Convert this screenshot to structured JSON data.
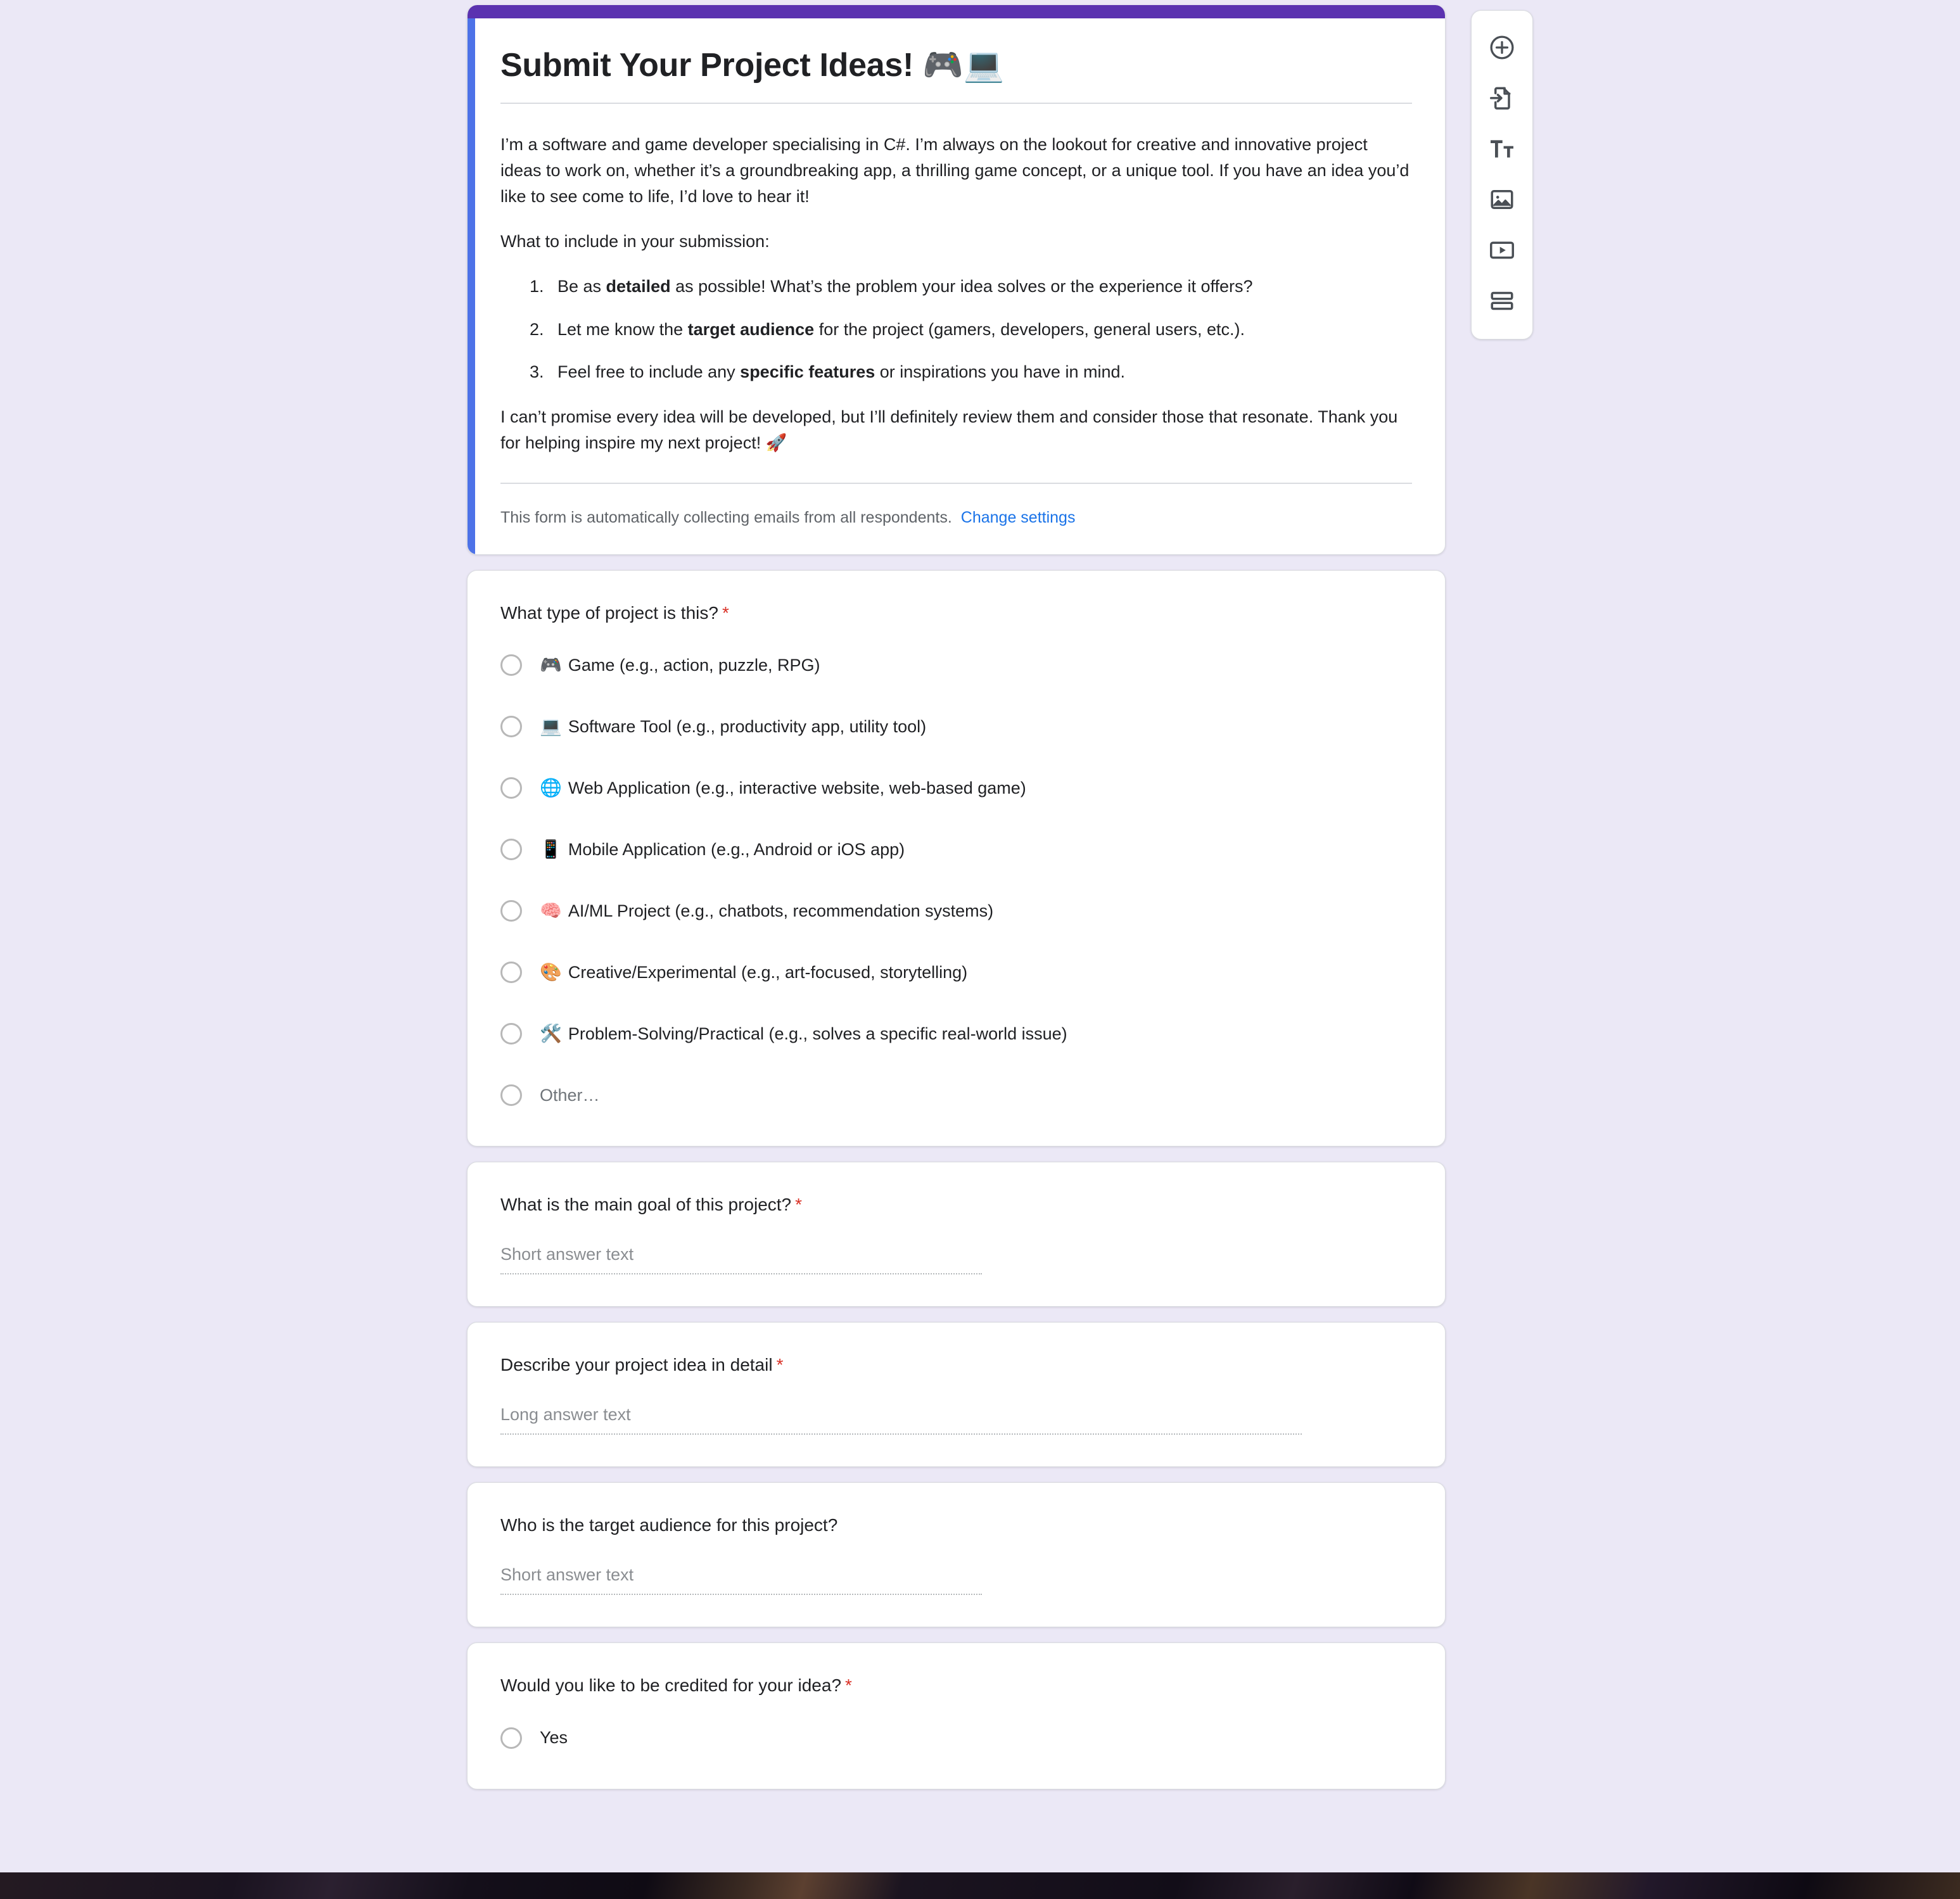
{
  "theme": {
    "header_bar_color": "#5b32b0",
    "selected_accent_color": "#4d72e8",
    "canvas_background": "#ebe8f6",
    "link_color": "#1a73e8",
    "required_star_color": "#d93025"
  },
  "header": {
    "title": "Submit Your Project Ideas! 🎮💻",
    "description_paragraphs": [
      "I’m a software and game developer specialising in C#. I’m always on the lookout for creative and innovative project ideas to work on, whether it’s a groundbreaking app, a thrilling game concept, or a unique tool. If you have an idea you’d like to see come to life, I’d love to hear it!",
      "What to include in your submission:"
    ],
    "list_items": [
      {
        "pre": "Be as ",
        "bold": "detailed",
        "post": " as possible! What’s the problem your idea solves or the experience it offers?"
      },
      {
        "pre": "Let me know the ",
        "bold": "target audience",
        "post": " for the project (gamers, developers, general users, etc.)."
      },
      {
        "pre": "Feel free to include any ",
        "bold": "specific features",
        "post": " or inspirations you have in mind."
      }
    ],
    "closing_paragraph": "I can’t promise every idea will be developed, but I’ll definitely review them and consider those that resonate. Thank you for helping inspire my next project! 🚀",
    "email_notice": "This form is automatically collecting emails from all respondents.",
    "email_notice_link": "Change settings"
  },
  "questions": [
    {
      "title": "What type of project is this?",
      "required": true,
      "type": "radio",
      "options": [
        {
          "emoji": "🎮",
          "label": "Game (e.g., action, puzzle, RPG)",
          "muted": false
        },
        {
          "emoji": "💻",
          "label": "Software Tool (e.g., productivity app, utility tool)",
          "muted": false
        },
        {
          "emoji": "🌐",
          "label": "Web Application (e.g., interactive website, web-based game)",
          "muted": false
        },
        {
          "emoji": "📱",
          "label": "Mobile Application (e.g., Android or iOS app)",
          "muted": false
        },
        {
          "emoji": "🧠",
          "label": "AI/ML Project (e.g., chatbots, recommendation systems)",
          "muted": false
        },
        {
          "emoji": "🎨",
          "label": "Creative/Experimental (e.g., art-focused, storytelling)",
          "muted": false
        },
        {
          "emoji": "🛠️",
          "label": "Problem-Solving/Practical (e.g., solves a specific real-world issue)",
          "muted": false
        },
        {
          "emoji": "",
          "label": "Other…",
          "muted": true
        }
      ]
    },
    {
      "title": "What is the main goal of this project?",
      "required": true,
      "type": "short_answer",
      "placeholder": "Short answer text"
    },
    {
      "title": "Describe your project idea in detail",
      "required": true,
      "type": "long_answer",
      "placeholder": "Long answer text"
    },
    {
      "title": "Who is the target audience for this project?",
      "required": false,
      "type": "short_answer",
      "placeholder": "Short answer text"
    },
    {
      "title": "Would you like to be credited for your idea?",
      "required": true,
      "type": "radio",
      "options": [
        {
          "emoji": "",
          "label": "Yes",
          "muted": false
        }
      ]
    }
  ],
  "side_toolbar": {
    "buttons": [
      {
        "icon": "add-question-icon",
        "label": "Add question"
      },
      {
        "icon": "import-questions-icon",
        "label": "Import questions"
      },
      {
        "icon": "add-title-description-icon",
        "label": "Add title and description"
      },
      {
        "icon": "add-image-icon",
        "label": "Add image"
      },
      {
        "icon": "add-video-icon",
        "label": "Add video"
      },
      {
        "icon": "add-section-icon",
        "label": "Add section"
      }
    ]
  }
}
